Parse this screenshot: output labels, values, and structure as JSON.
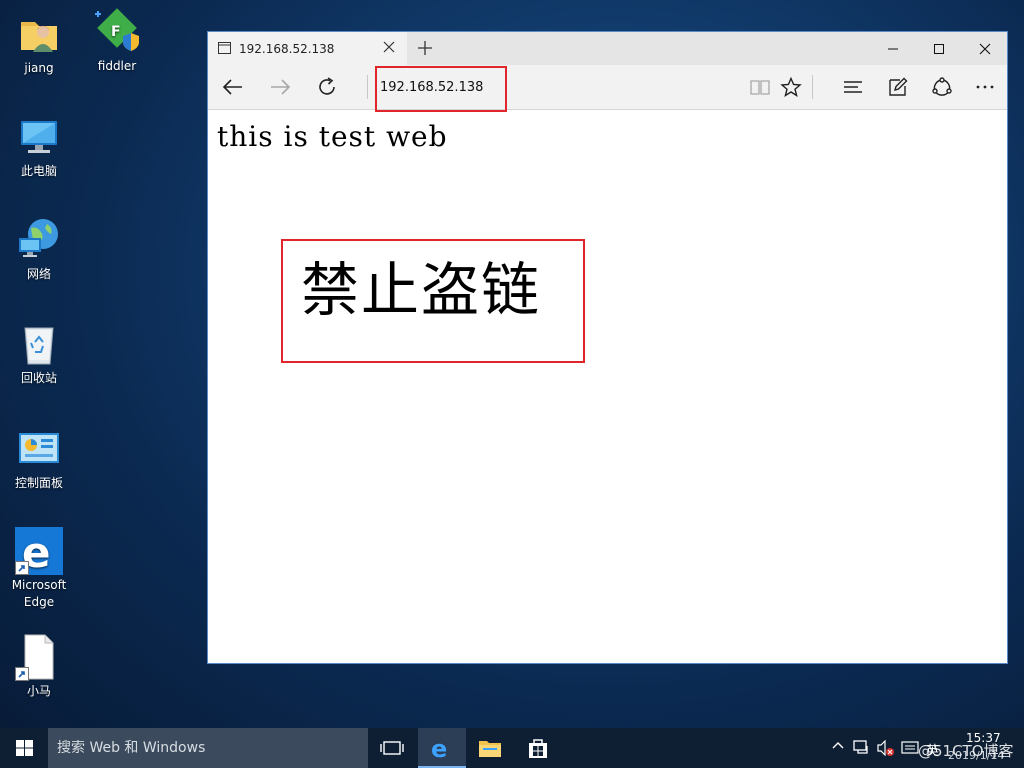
{
  "desktop": {
    "icons": [
      {
        "label": "jiang"
      },
      {
        "label": "fiddler"
      },
      {
        "label": "此电脑"
      },
      {
        "label": "网络"
      },
      {
        "label": "回收站"
      },
      {
        "label": "控制面板"
      },
      {
        "label": "Microsoft Edge"
      },
      {
        "label": "小马"
      }
    ]
  },
  "browser": {
    "tab_title": "192.168.52.138",
    "address": "192.168.52.138",
    "page_text": "this is test web"
  },
  "annotation": {
    "note": "禁止盗链",
    "color": "#e0262b"
  },
  "taskbar": {
    "search_placeholder": "搜索 Web 和 Windows",
    "ime": "英",
    "watermark": "@51CTO博客",
    "time": "15:37",
    "date": "2019/1/14"
  },
  "colors": {
    "accent": "#0078d7",
    "taskbar": "#0f1f33",
    "annotation": "#e0262b"
  }
}
